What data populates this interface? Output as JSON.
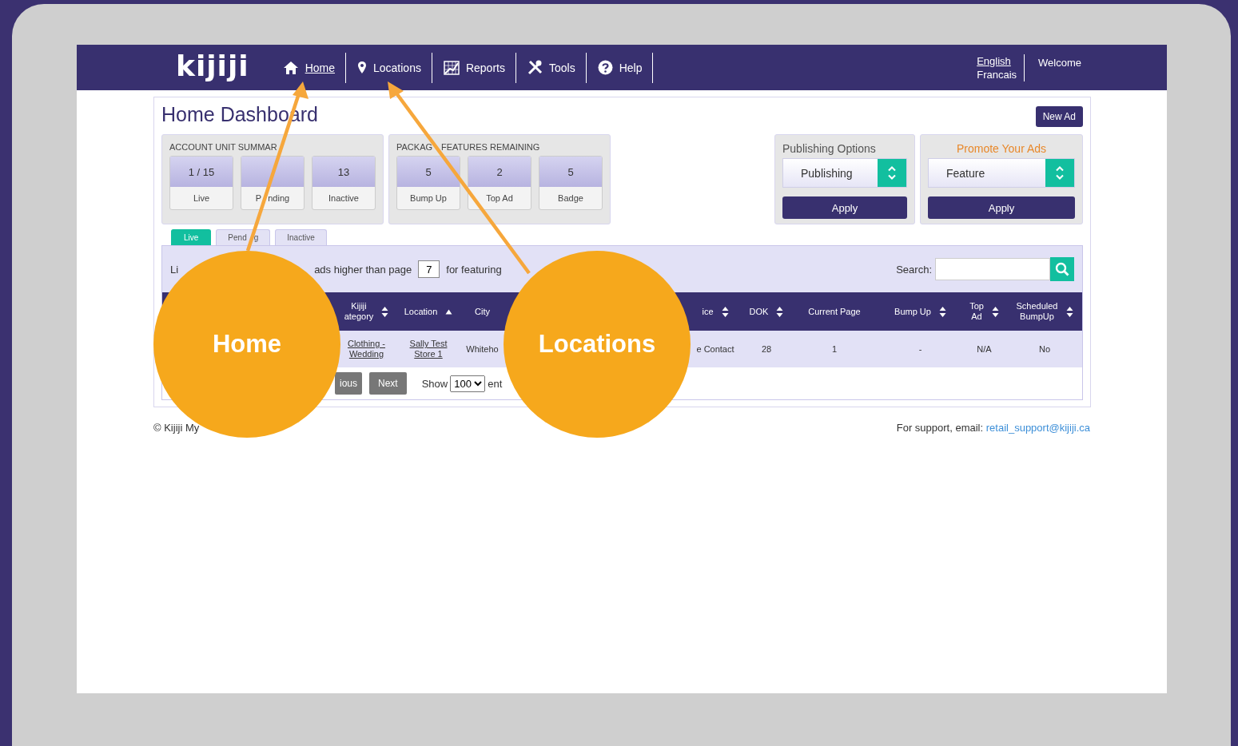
{
  "nav": {
    "logo": "kijiji",
    "items": [
      {
        "label": "Home",
        "selected": true
      },
      {
        "label": "Locations",
        "selected": false
      },
      {
        "label": "Reports",
        "selected": false
      },
      {
        "label": "Tools",
        "selected": false
      },
      {
        "label": "Help",
        "selected": false
      }
    ],
    "languages": [
      {
        "label": "English",
        "selected": true
      },
      {
        "label": "Francais",
        "selected": false
      }
    ],
    "welcome": "Welcome"
  },
  "page": {
    "title": "Home Dashboard",
    "new_ad": "New Ad"
  },
  "summaries": [
    {
      "title": "ACCOUNT UNIT SUMMAR",
      "tiles": [
        {
          "value": "1 / 15",
          "label": "Live"
        },
        {
          "label_parts": [
            "P",
            "nding"
          ]
        },
        {
          "value": "13",
          "label": "Inactive"
        }
      ]
    },
    {
      "title_parts": [
        "PACKAG",
        "FEATURES REMAINING"
      ],
      "tiles": [
        {
          "value": "5",
          "label": "Bump Up"
        },
        {
          "value": "2",
          "label": "Top Ad"
        },
        {
          "value": "5",
          "label": "Badge"
        }
      ]
    }
  ],
  "options": [
    {
      "title": "Publishing Options",
      "accent": false,
      "select": "Publishing",
      "button": "Apply"
    },
    {
      "title": "Promote Your Ads",
      "accent": true,
      "select": "Feature",
      "button": "Apply"
    }
  ],
  "tabs": [
    {
      "label": "Live",
      "selected": true
    },
    {
      "label_parts": [
        "Pend",
        "g"
      ],
      "selected": false
    },
    {
      "label": "Inactive",
      "selected": false
    }
  ],
  "list": {
    "title": "Li",
    "filter_text": "ads higher than page",
    "page_value": "7",
    "filter_suffix": "for featuring",
    "search_label": "Search:"
  },
  "columns": [
    {
      "kind": "plain"
    },
    {
      "label": "Kijiji\nategory",
      "kind": "sortable"
    },
    {
      "label": "Location",
      "kind": "sorted"
    },
    {
      "label": "City",
      "kind": "plain"
    },
    {
      "kind": "plain"
    },
    {
      "label": "ice",
      "kind": "sortable"
    },
    {
      "label": "DOK",
      "kind": "sortable"
    },
    {
      "label": "Current Page",
      "kind": "plain"
    },
    {
      "label": "Bump Up",
      "kind": "sortable"
    },
    {
      "label": "Top\nAd",
      "kind": "sortable"
    },
    {
      "label": "Scheduled\nBumpUp",
      "kind": "sortable"
    }
  ],
  "rows": [
    {
      "cells": [
        {},
        {
          "text": "Clothing -\nWedding",
          "link": true
        },
        {
          "text": "Sally Test\nStore 1",
          "link": true
        },
        {
          "text": "Whiteho",
          "link": false
        },
        {},
        {
          "text": "e Contact",
          "link": false
        },
        {
          "text": "28",
          "link": false
        },
        {
          "text": "1",
          "link": false
        },
        {
          "text": "-",
          "link": false
        },
        {
          "text": "N/A",
          "link": false
        },
        {
          "text": "No",
          "link": false
        }
      ]
    }
  ],
  "pagination": {
    "previous": "ious",
    "next": "Next",
    "show": "Show",
    "page_size": "100",
    "entries": "ent"
  },
  "footer": {
    "copyright": "© Kijiji My",
    "support": "For support, email:",
    "email": "retail_support@kijiji.ca"
  },
  "callouts": [
    {
      "label": "Home"
    },
    {
      "label": "Locations"
    }
  ]
}
